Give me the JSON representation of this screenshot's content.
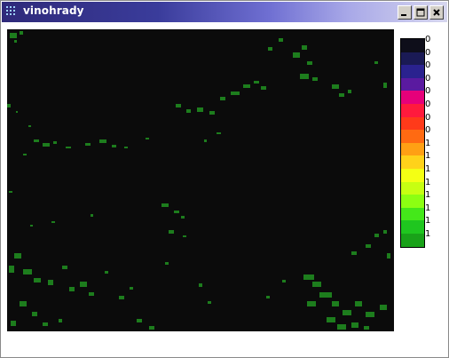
{
  "window": {
    "title": "vinohrady",
    "title_icon": "grid-dots-icon",
    "controls": [
      "minimize-icon",
      "maximize-icon",
      "close-icon"
    ]
  },
  "map": {
    "description_icon": "raster-map",
    "background_color": "#0b0b0b",
    "feature_color": "#1f8a1f"
  },
  "legend": {
    "entries": [
      {
        "color": "#0e0e1a",
        "label": "0"
      },
      {
        "color": "#1a1a55",
        "label": "0"
      },
      {
        "color": "#2a228f",
        "label": "0"
      },
      {
        "color": "#5a1aa0",
        "label": "0"
      },
      {
        "color": "#e6007a",
        "label": "0"
      },
      {
        "color": "#ff1a3d",
        "label": "0"
      },
      {
        "color": "#ff3a1a",
        "label": "0"
      },
      {
        "color": "#ff6a12",
        "label": "0"
      },
      {
        "color": "#ffa014",
        "label": "1"
      },
      {
        "color": "#ffd21a",
        "label": "1"
      },
      {
        "color": "#f4ff14",
        "label": "1"
      },
      {
        "color": "#c7ff12",
        "label": "1"
      },
      {
        "color": "#8cff12",
        "label": "1"
      },
      {
        "color": "#44e81a",
        "label": "1"
      },
      {
        "color": "#1fc61f",
        "label": "1"
      },
      {
        "color": "#19a219",
        "label": "1"
      }
    ]
  }
}
